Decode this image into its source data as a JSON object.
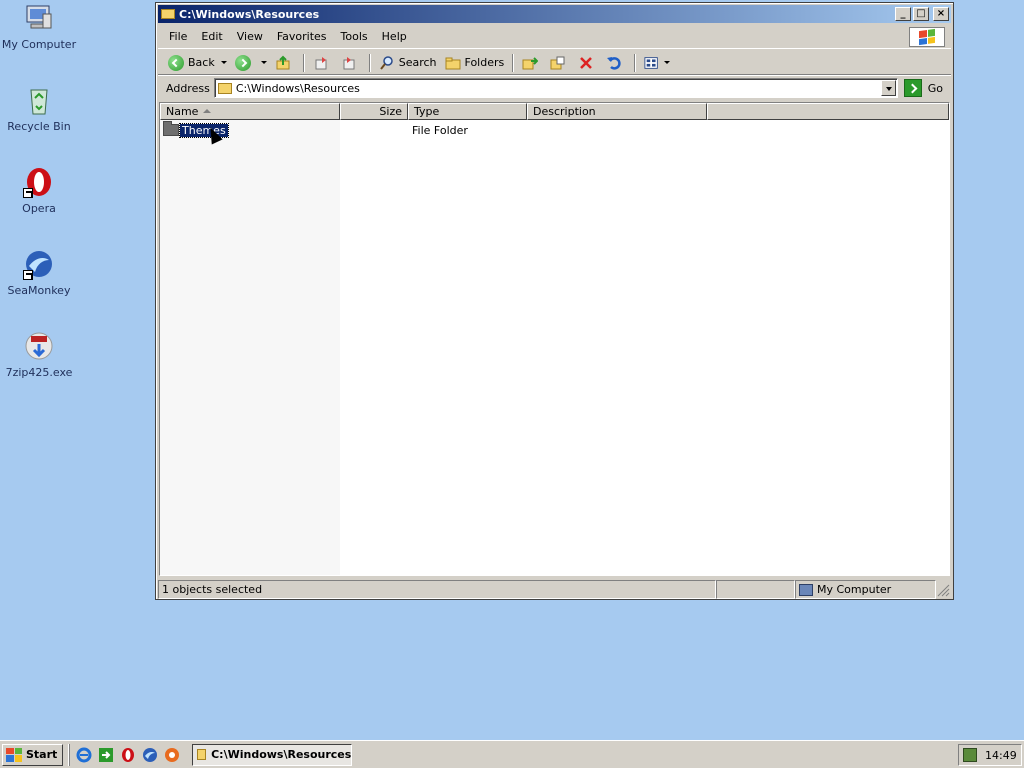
{
  "desktop": {
    "icons": [
      {
        "label": "My Computer",
        "icon": "my-computer-icon"
      },
      {
        "label": "Recycle Bin",
        "icon": "recycle-bin-icon"
      },
      {
        "label": "Opera",
        "icon": "opera-icon"
      },
      {
        "label": "SeaMonkey",
        "icon": "seamonkey-icon"
      },
      {
        "label": "7zip425.exe",
        "icon": "installer-icon"
      }
    ]
  },
  "window": {
    "title": "C:\\Windows\\Resources",
    "controls": {
      "minimize": "_",
      "maximize": "□",
      "close": "×"
    },
    "menu": [
      "File",
      "Edit",
      "View",
      "Favorites",
      "Tools",
      "Help"
    ],
    "toolbar": {
      "back": "Back",
      "search": "Search",
      "folders": "Folders"
    },
    "address": {
      "label": "Address",
      "value": "C:\\Windows\\Resources",
      "go": "Go"
    },
    "columns": [
      "Name",
      "Size",
      "Type",
      "Description"
    ],
    "rows": [
      {
        "name": "Themes",
        "size": "",
        "type": "File Folder",
        "description": ""
      }
    ],
    "status": {
      "selection": "1 objects selected",
      "location": "My Computer"
    }
  },
  "taskbar": {
    "start": "Start",
    "quick_launch": [
      "ie-icon",
      "show-desktop-icon",
      "opera-icon",
      "seamonkey-icon",
      "firefox-icon"
    ],
    "active_task": "C:\\Windows\\Resources",
    "clock": "14:49"
  },
  "colors": {
    "desktop": "#a6caf0",
    "title_active": "#0a246a",
    "selection": "#0a246a",
    "chrome": "#d4d0c8"
  }
}
